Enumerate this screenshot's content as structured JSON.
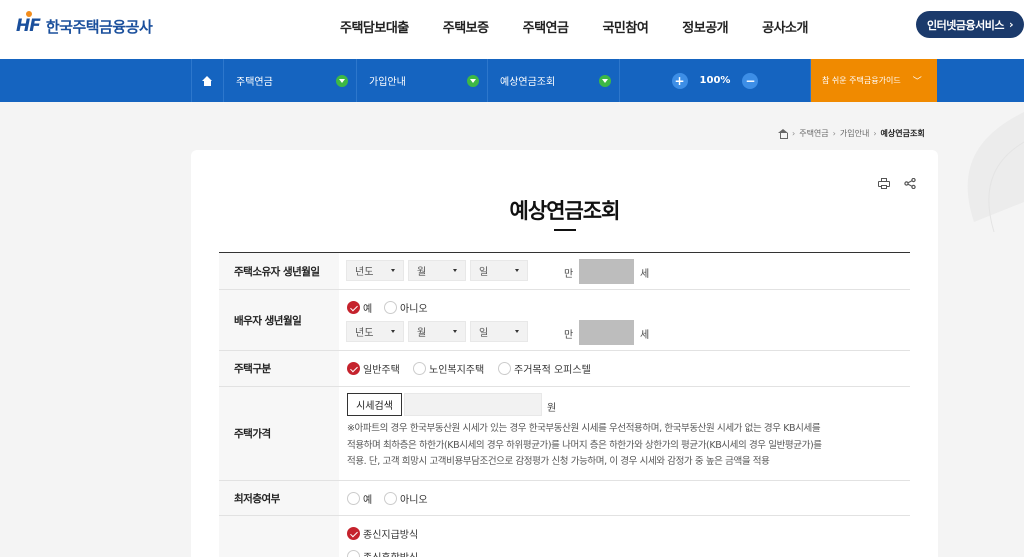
{
  "header": {
    "logo_mark": "HF",
    "logo_text": "한국주택금융공사",
    "gnb": [
      "주택담보대출",
      "주택보증",
      "주택연금",
      "국민참여",
      "정보공개",
      "공사소개"
    ],
    "internet_service": "인터넷금융서비스"
  },
  "navbar": {
    "selects": [
      "주택연금",
      "가입안내",
      "예상연금조회"
    ],
    "zoom_value": "100%",
    "zoom_plus": "+",
    "zoom_minus": "−",
    "guide": "참 쉬운 주택금융가이드"
  },
  "breadcrumb": [
    "주택연금",
    "가입안내",
    "예상연금조회"
  ],
  "page_title": "예상연금조회",
  "form": {
    "owner_birth": {
      "label": "주택소유자 생년월일",
      "year": "년도",
      "month": "월",
      "day": "일",
      "age_prefix": "만",
      "age_suffix": "세"
    },
    "spouse_birth": {
      "label": "배우자 생년월일",
      "yes": "예",
      "no": "아니오",
      "year": "년도",
      "month": "월",
      "day": "일",
      "age_prefix": "만",
      "age_suffix": "세"
    },
    "house_type": {
      "label": "주택구분",
      "options": [
        "일반주택",
        "노인복지주택",
        "주거목적 오피스텔"
      ]
    },
    "house_price": {
      "label": "주택가격",
      "search_button": "시세검색",
      "unit": "원",
      "note_lines": [
        "※아파트의 경우 한국부동산원 시세가 있는 경우 한국부동산원 시세를 우선적용하며, 한국부동산원 시세가 없는 경우 KB시세를",
        "적용하며 최하층은 하한가(KB시세의 경우 하위평균가)를 나머지 층은 하한가와 상한가의 평균가(KB시세의 경우 일반평균가)를",
        "적용. 단, 고객 희망시 고객비용부담조건으로 감정평가 신청 가능하며, 이 경우 시세와 감정가 중 높은 금액을 적용"
      ]
    },
    "lowest_floor": {
      "label": "최저층여부",
      "yes": "예",
      "no": "아니오"
    },
    "payment": {
      "options": [
        "종신지급방식",
        "종신혼합방식"
      ]
    }
  },
  "colors": {
    "brand_blue": "#1564c0",
    "brand_navy": "#1b3a6b",
    "guide_orange": "#f08a00",
    "radio_red": "#c5232d",
    "dot_green": "#3db845"
  }
}
